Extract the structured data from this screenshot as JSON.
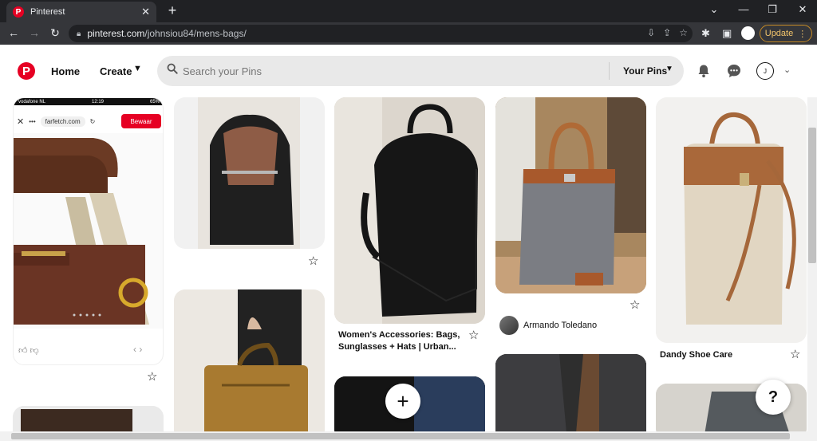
{
  "browser": {
    "tab_title": "Pinterest",
    "favicon_letter": "P",
    "url_domain": "pinterest.com",
    "url_path": "/johnsiou84/mens-bags/",
    "update_label": "Update"
  },
  "header": {
    "logo_letter": "P",
    "home_label": "Home",
    "create_label": "Create",
    "search_placeholder": "Search your Pins",
    "your_pins_label": "Your Pins",
    "avatar_initial": "J"
  },
  "pins": [
    {
      "id": "phone-farfetch",
      "site": "farfetch.com",
      "save_label": "Bewaar",
      "carrier": "vodafone NL",
      "time": "12:19",
      "battery": "65%"
    },
    {
      "id": "open-black-bag"
    },
    {
      "id": "black-leather-backpack",
      "caption": "Women's Accessories: Bags, Sunglasses + Hats | Urban..."
    },
    {
      "id": "grey-felt-tote",
      "author": "Armando Toledano"
    },
    {
      "id": "canvas-backpack",
      "caption": "Dandy Shoe Care"
    },
    {
      "id": "tan-briefcase"
    },
    {
      "id": "dark-bag-partial"
    },
    {
      "id": "croc-jacket"
    },
    {
      "id": "grey-coat"
    },
    {
      "id": "left-partial"
    }
  ],
  "help_label": "?",
  "colors": {
    "brand": "#e60023",
    "update_border": "#c58a25"
  }
}
